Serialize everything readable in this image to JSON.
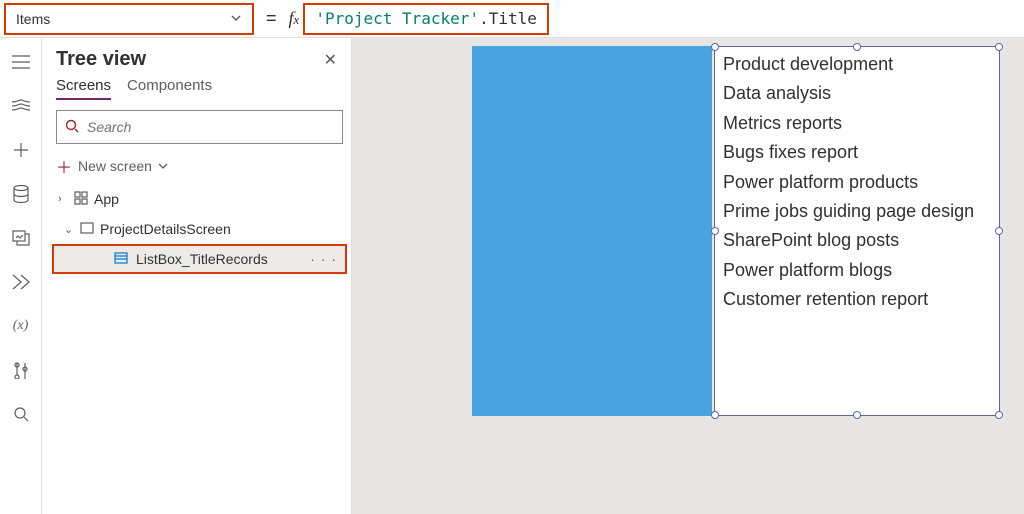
{
  "property_selector": {
    "value": "Items"
  },
  "formula": {
    "source": "'Project Tracker'",
    "member": ".Title"
  },
  "tree": {
    "title": "Tree view",
    "tabs": {
      "screens": "Screens",
      "components": "Components"
    },
    "search_placeholder": "Search",
    "new_screen": "New screen",
    "nodes": {
      "app": "App",
      "screen": "ProjectDetailsScreen",
      "listbox": "ListBox_TitleRecords"
    }
  },
  "listbox": {
    "items": [
      "Product development",
      "Data analysis",
      "Metrics reports",
      "Bugs fixes report",
      "Power platform products",
      "Prime jobs guiding page design",
      "SharePoint blog posts",
      "Power platform blogs",
      "Customer retention report"
    ]
  }
}
